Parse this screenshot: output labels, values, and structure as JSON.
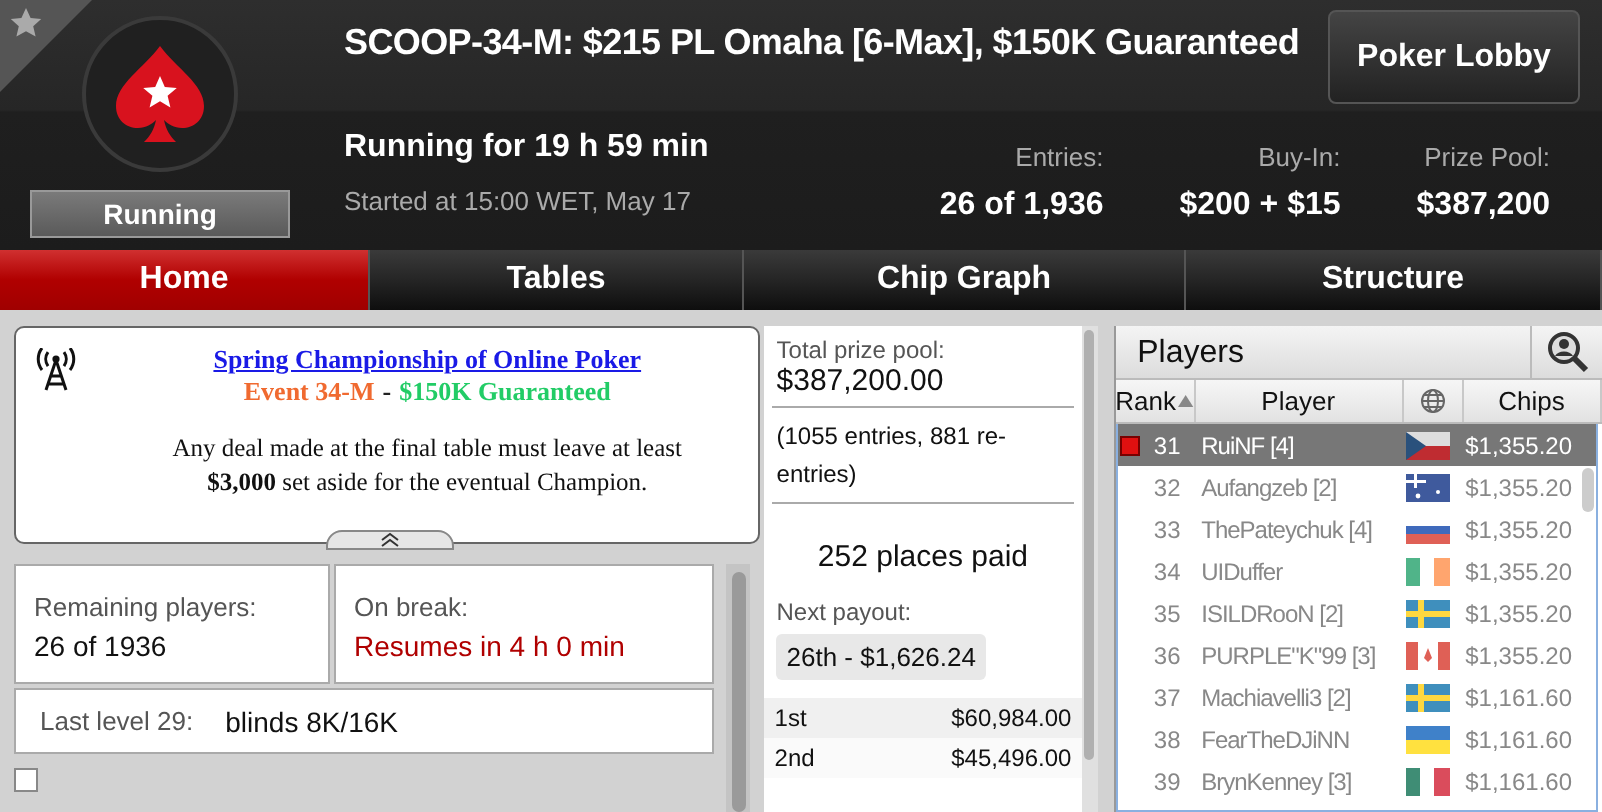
{
  "header": {
    "title": "SCOOP-34-M: $215 PL Omaha [6-Max], $150K Guaranteed",
    "status": "Running",
    "running_for": "Running for 19 h 59 min",
    "started": "Started at 15:00 WET, May 17",
    "lobby_button": "Poker Lobby",
    "stats": [
      {
        "label": "Entries:",
        "value": "26 of 1,936"
      },
      {
        "label": "Buy-In:",
        "value": "$200 + $15"
      },
      {
        "label": "Prize Pool:",
        "value": "$387,200"
      }
    ]
  },
  "tabs": [
    {
      "label": "Home",
      "selected": true
    },
    {
      "label": "Tables",
      "selected": false
    },
    {
      "label": "Chip Graph",
      "selected": false
    },
    {
      "label": "Structure",
      "selected": false
    }
  ],
  "announcement": {
    "link": "Spring Championship of Online Poker",
    "event": "Event 34-M",
    "separator": "-",
    "guarantee": "$150K Guaranteed",
    "body": "Any deal made at the final table must leave at least **$3,000** set aside for the eventual Champion."
  },
  "info": {
    "remaining_label": "Remaining players:",
    "remaining_value": "26 of 1936",
    "break_label": "On break:",
    "break_value": "Resumes in 4 h 0 min",
    "level_label": "Last level 29:",
    "level_value": "blinds 8K/16K",
    "checkbox_checked": false
  },
  "prizes": {
    "total_label": "Total prize pool:",
    "total_value": "$387,200.00",
    "entries_note": "(1055 entries, 881 re-entries)",
    "places_paid": "252 places paid",
    "next_label": "Next payout:",
    "next_value": "26th - $1,626.24",
    "rows": [
      {
        "place": "1st",
        "amount": "$60,984.00"
      },
      {
        "place": "2nd",
        "amount": "$45,496.00"
      }
    ]
  },
  "players": {
    "title": "Players",
    "columns": [
      "Rank",
      "Player",
      "Chips"
    ],
    "rows": [
      {
        "rank": "31",
        "name": "RuiNF [4]",
        "kind": "cz",
        "chips": "$1,355.20",
        "selected": true,
        "marked": true
      },
      {
        "rank": "32",
        "name": "Aufangzeb [2]",
        "kind": "au",
        "chips": "$1,355.20",
        "selected": false,
        "marked": false
      },
      {
        "rank": "33",
        "name": "ThePateychuk [4]",
        "kind": "ru",
        "chips": "$1,355.20",
        "selected": false,
        "marked": false
      },
      {
        "rank": "34",
        "name": "UIDuffer",
        "kind": "ie",
        "chips": "$1,355.20",
        "selected": false,
        "marked": false
      },
      {
        "rank": "35",
        "name": "ISILDRooN [2]",
        "kind": "se",
        "chips": "$1,355.20",
        "selected": false,
        "marked": false
      },
      {
        "rank": "36",
        "name": "PURPLE\"K\"99 [3]",
        "kind": "ca",
        "chips": "$1,355.20",
        "selected": false,
        "marked": false
      },
      {
        "rank": "37",
        "name": "Machiavelli3 [2]",
        "kind": "se",
        "chips": "$1,161.60",
        "selected": false,
        "marked": false
      },
      {
        "rank": "38",
        "name": "FearTheDJiNN",
        "kind": "ua",
        "chips": "$1,161.60",
        "selected": false,
        "marked": false
      },
      {
        "rank": "39",
        "name": "BrynKenney [3]",
        "kind": "mx",
        "chips": "$1,161.60",
        "selected": false,
        "marked": false
      }
    ]
  }
}
